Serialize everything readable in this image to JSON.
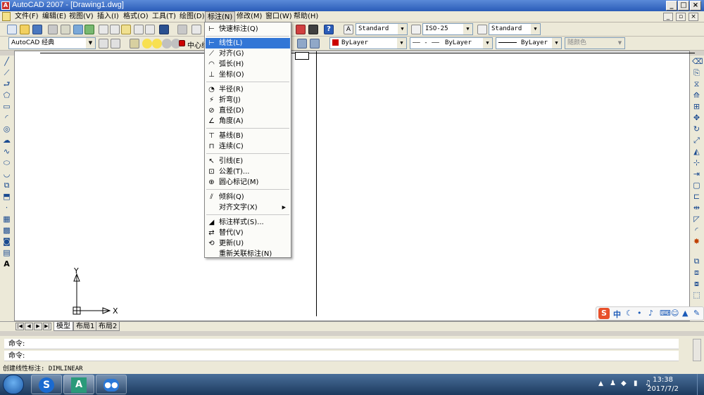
{
  "window": {
    "title": "AutoCAD 2007 - [Drawing1.dwg]",
    "app_badge": "A"
  },
  "menubar": {
    "items": [
      "文件(F)",
      "编辑(E)",
      "视图(V)",
      "插入(I)",
      "格式(O)",
      "工具(T)",
      "绘图(D)",
      "标注(N)",
      "修改(M)",
      "窗口(W)",
      "帮助(H)"
    ],
    "active_index": 7
  },
  "toolbar": {
    "text_style": "Standard",
    "dim_style": "ISO-25",
    "table_style": "Standard",
    "workspace": "AutoCAD 经典",
    "layer": "中心线",
    "color": "ByLayer",
    "linetype": "ByLayer",
    "lineweight": "ByLayer",
    "plot_style": "随颜色",
    "linetype_preview": "—— - ——"
  },
  "dim_menu": {
    "items": [
      {
        "label": "快速标注(Q)",
        "icon": "quick-dim-icon"
      },
      {
        "label": "线性(L)",
        "icon": "linear-dim-icon",
        "highlighted": true
      },
      {
        "label": "对齐(G)",
        "icon": "aligned-dim-icon"
      },
      {
        "label": "弧长(H)",
        "icon": "arc-length-icon"
      },
      {
        "label": "坐标(O)",
        "icon": "ordinate-icon"
      },
      {
        "label": "半径(R)",
        "icon": "radius-icon"
      },
      {
        "label": "折弯(J)",
        "icon": "jogged-icon"
      },
      {
        "label": "直径(D)",
        "icon": "diameter-icon"
      },
      {
        "label": "角度(A)",
        "icon": "angular-icon"
      },
      {
        "label": "基线(B)",
        "icon": "baseline-icon"
      },
      {
        "label": "连续(C)",
        "icon": "continue-icon"
      },
      {
        "label": "引线(E)",
        "icon": "leader-icon"
      },
      {
        "label": "公差(T)...",
        "icon": "tolerance-icon"
      },
      {
        "label": "圆心标记(M)",
        "icon": "center-mark-icon"
      },
      {
        "label": "倾斜(Q)",
        "icon": "oblique-icon"
      },
      {
        "label": "对齐文字(X)",
        "icon": "",
        "submenu": true
      },
      {
        "label": "标注样式(S)...",
        "icon": "dim-style-icon"
      },
      {
        "label": "替代(V)",
        "icon": "override-icon"
      },
      {
        "label": "更新(U)",
        "icon": "update-icon"
      },
      {
        "label": "重新关联标注(N)",
        "icon": ""
      }
    ]
  },
  "ucs": {
    "x_label": "X",
    "y_label": "Y"
  },
  "tabs": [
    "模型",
    "布局1",
    "布局2"
  ],
  "command": {
    "line1": "命令:",
    "line2": "命令:"
  },
  "status_text": "创建线性标注:  DIMLINEAR",
  "clock": {
    "time": "13:38",
    "date": "2017/7/2"
  },
  "ime": {
    "lang": "中"
  },
  "colors": {
    "title": "#2a5cb8",
    "highlight": "#3276d6",
    "bylayer_swatch": "#cc0000"
  }
}
